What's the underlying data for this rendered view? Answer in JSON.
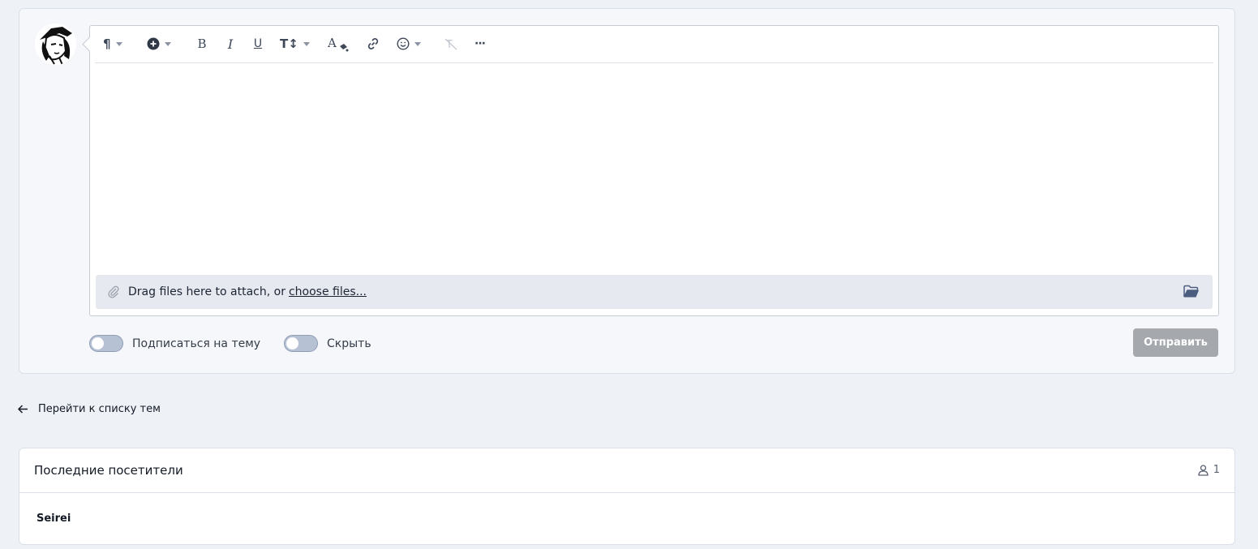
{
  "editor": {
    "toolbar": [
      {
        "name": "paragraph-format-button",
        "icon": "paragraph-icon"
      },
      {
        "name": "insert-button",
        "icon": "plus-circle-icon"
      },
      {
        "name": "bold-button",
        "icon": "bold-icon"
      },
      {
        "name": "italic-button",
        "icon": "italic-icon"
      },
      {
        "name": "underline-button",
        "icon": "underline-icon"
      },
      {
        "name": "font-size-button",
        "icon": "text-height-icon"
      },
      {
        "name": "text-color-button",
        "icon": "text-color-icon"
      },
      {
        "name": "insert-link-button",
        "icon": "link-icon"
      },
      {
        "name": "emoji-button",
        "icon": "smile-icon"
      },
      {
        "name": "clear-format-button",
        "icon": "remove-format-icon"
      },
      {
        "name": "more-options-button",
        "icon": "ellipsis-icon"
      }
    ],
    "attach_text": "Drag files here to attach, or",
    "attach_link": "choose files...",
    "folder_icon": "folder-open-icon"
  },
  "options": {
    "subscribe_label": "Подписаться на тему",
    "hide_label": "Скрыть",
    "subscribe_on": false,
    "hide_on": false
  },
  "send_button": "Отправить",
  "back_link": "Перейти к списку тем",
  "visitors": {
    "title": "Последние посетители",
    "count": "1",
    "names": [
      "Seirei"
    ]
  },
  "colors": {
    "page_bg": "#eef1f6",
    "send_disabled": "#a5a8ad",
    "toggle_off": "#b6c1d3"
  }
}
